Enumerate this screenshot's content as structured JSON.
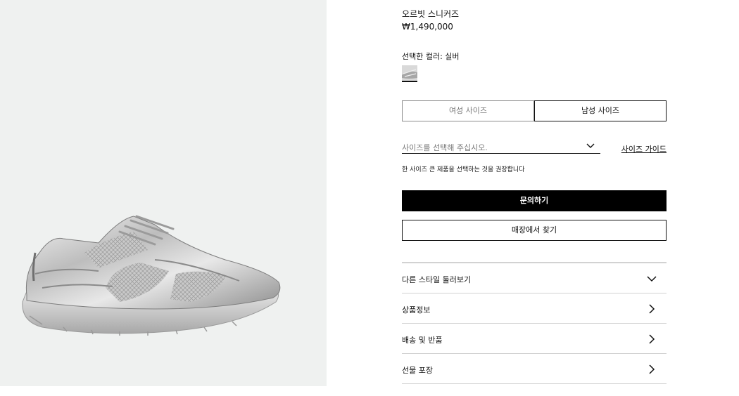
{
  "product": {
    "title": "오르빗 스니커즈",
    "price": "₩1,490,000",
    "color_label": "선택한 컬러: 실버"
  },
  "size_tabs": [
    {
      "label": "여성 사이즈",
      "selected": false
    },
    {
      "label": "남성 사이즈",
      "selected": true
    }
  ],
  "size_select": {
    "placeholder": "사이즈를 선택해 주십시오.",
    "guide_label": "사이즈 가이드"
  },
  "size_note": "한 사이즈 큰 제품을 선택하는 것을 권장합니다",
  "buttons": {
    "inquire": "문의하기",
    "find_store": "매장에서 찾기"
  },
  "accordion": [
    {
      "label": "다른 스타일 둘러보기",
      "icon": "chevron-down-icon"
    },
    {
      "label": "상품정보",
      "icon": "chevron-right-icon"
    },
    {
      "label": "배송 및 반품",
      "icon": "chevron-right-icon"
    },
    {
      "label": "선물 포장",
      "icon": "chevron-right-icon"
    }
  ],
  "colors": {
    "image_background": "#eff1f0",
    "primary_button": "#000000",
    "divider": "#d2d2d2"
  }
}
